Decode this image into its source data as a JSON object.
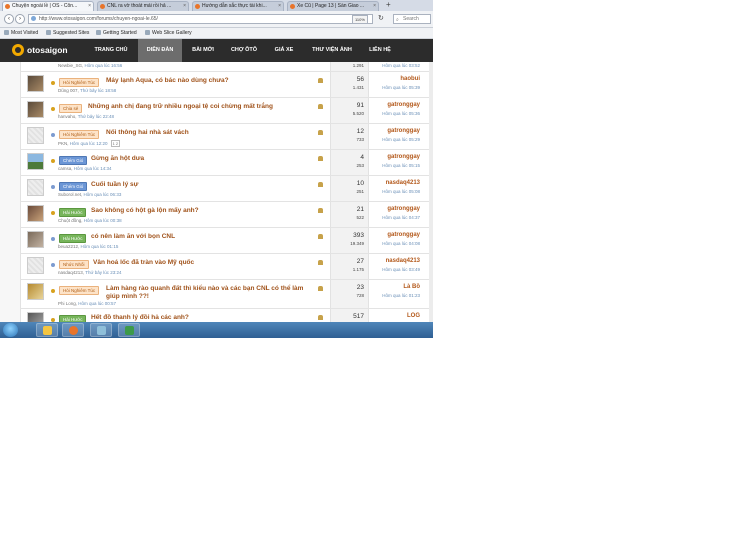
{
  "browser": {
    "tabs": [
      {
        "label": "Chuyện ngoài lề | OS - Côn..."
      },
      {
        "label": "CNL ra vờ thoát mái rồi hả ..."
      },
      {
        "label": "Hướng dẫn sắc thực tài khi..."
      },
      {
        "label": "Xe Cũ | Page 13 | Sàn Giao ..."
      }
    ],
    "new_tab_label": "+",
    "url": "http://www.otosaigon.com/forums/chuyen-ngoai-le.65/",
    "zoom": "110%",
    "search_placeholder": "Search",
    "bookmarks": [
      "Most Visited",
      "Suggested Sites",
      "Getting Started",
      "Web Slice Gallery"
    ]
  },
  "site": {
    "logo_text": "otosaigon",
    "menu": [
      "TRANG CHỦ",
      "DIỄN ĐÀN",
      "BÀI MỚI",
      "CHỢ ÔTÔ",
      "GIÁ XE",
      "THƯ VIỆN ẢNH",
      "LIÊN HỆ"
    ],
    "active_menu": "DIỄN ĐÀN"
  },
  "partial_row": {
    "author": "Newbie_SG",
    "time": "Hôm qua lúc 16:56",
    "views": "1.291",
    "last_time": "Hôm qua lúc 03:52"
  },
  "threads": [
    {
      "prefix": "Hỏi Nghiêm Túc",
      "prefix_color": "orange",
      "title": "Máy lạnh Aqua, có bác nào dùng chưa?",
      "author": "Dũng 007",
      "time": "Thứ bảy lúc 18:58",
      "replies": "56",
      "views": "1.431",
      "last_user": "haobui",
      "last_time": "Hôm qua lúc 05:39",
      "dot_color": "#d8a21e",
      "avatar": "photo"
    },
    {
      "prefix": "Chia sẻ",
      "prefix_color": "orange",
      "title": "Những anh chị đang trữ nhiều ngoại tệ coi chừng mất trắng",
      "author": "hanvaho",
      "time": "Thứ bảy lúc 22:48",
      "replies": "91",
      "views": "5.520",
      "last_user": "gatronggay",
      "last_time": "Hôm qua lúc 05:36",
      "dot_color": "#d8a21e",
      "avatar": "photo"
    },
    {
      "prefix": "Hỏi Nghiêm Túc",
      "prefix_color": "orange",
      "title": "Nối thông hai nhà sát vách",
      "author": "PKN",
      "time": "Hôm qua lúc 12:20",
      "pager": "1 2",
      "replies": "12",
      "views": "733",
      "last_user": "gatronggay",
      "last_time": "Hôm qua lúc 05:29",
      "dot_color": "#7c9bd0",
      "avatar": "placeholder"
    },
    {
      "prefix": "Chém Gió",
      "prefix_color": "blue",
      "title": "Gừng ăn hột dưa",
      "author": "camsa",
      "time": "Hôm qua lúc 14:34",
      "replies": "4",
      "views": "253",
      "last_user": "gatronggay",
      "last_time": "Hôm qua lúc 05:15",
      "dot_color": "#d8a21e",
      "avatar": "landscape"
    },
    {
      "prefix": "Chém Gió",
      "prefix_color": "blue",
      "title": "Cuối tuần lý sự",
      "author": "Suborol.net",
      "time": "Hôm qua lúc 06:33",
      "replies": "10",
      "views": "251",
      "last_user": "nasdaq4213",
      "last_time": "Hôm qua lúc 05:08",
      "dot_color": "#7c9bd0",
      "avatar": "placeholder"
    },
    {
      "prefix": "Hài Hước",
      "prefix_color": "green",
      "title": "Sao không có hột gà lộn mấy anh?",
      "author": "Chuột đồng",
      "time": "Hôm qua lúc 00:38",
      "replies": "21",
      "views": "522",
      "last_user": "gatronggay",
      "last_time": "Hôm qua lúc 04:37",
      "dot_color": "#d8a21e",
      "avatar": "photo2"
    },
    {
      "prefix": "Hài Hước",
      "prefix_color": "green",
      "title": "có nên làm ăn với bọn CNL",
      "author": "beua2212",
      "time": "Hôm qua lúc 01:15",
      "replies": "393",
      "views": "19.349",
      "last_user": "gatronggay",
      "last_time": "Hôm qua lúc 04:08",
      "dot_color": "#7c9bd0",
      "avatar": "photo3"
    },
    {
      "prefix": "Nhức Nhối",
      "prefix_color": "orange",
      "title": "Vân hoá lốc đã tràn vào Mỹ quốc",
      "author": "nasdaq4213",
      "time": "Thứ bảy lúc 23:24",
      "replies": "27",
      "views": "1.175",
      "last_user": "nasdaq4213",
      "last_time": "Hôm qua lúc 03:49",
      "dot_color": "#7c9bd0",
      "avatar": "placeholder"
    },
    {
      "prefix": "Hỏi Nghiêm Túc",
      "prefix_color": "orange",
      "title": "Làm hàng rào quanh đất thì kiểu nào và các bạn CNL có thể làm giúp mình ??!",
      "author": "Phi Long",
      "time": "Hôm qua lúc 00:57",
      "replies": "23",
      "views": "728",
      "last_user": "Là Bồ",
      "last_time": "Hôm qua lúc 01:23",
      "dot_color": "#d8a21e",
      "avatar": "photo4"
    },
    {
      "prefix": "Hài Hước",
      "prefix_color": "green",
      "title": "Hết đồ thanh lý đồi hả các anh?",
      "author": "",
      "time": "",
      "replies": "517",
      "views": "",
      "last_user": "LOG",
      "last_time": "",
      "dot_color": "#d8a21e",
      "avatar": "photo5"
    }
  ],
  "colors": {
    "site_header": "#2c2c2c",
    "thread_title": "#a0521a",
    "last_poster": "#b3581a",
    "taskbar": "#2f5f93"
  },
  "taskbar": {
    "icons": [
      "start-orb",
      "file-explorer-icon",
      "firefox-icon",
      "folder-icon",
      "excel-icon"
    ]
  }
}
